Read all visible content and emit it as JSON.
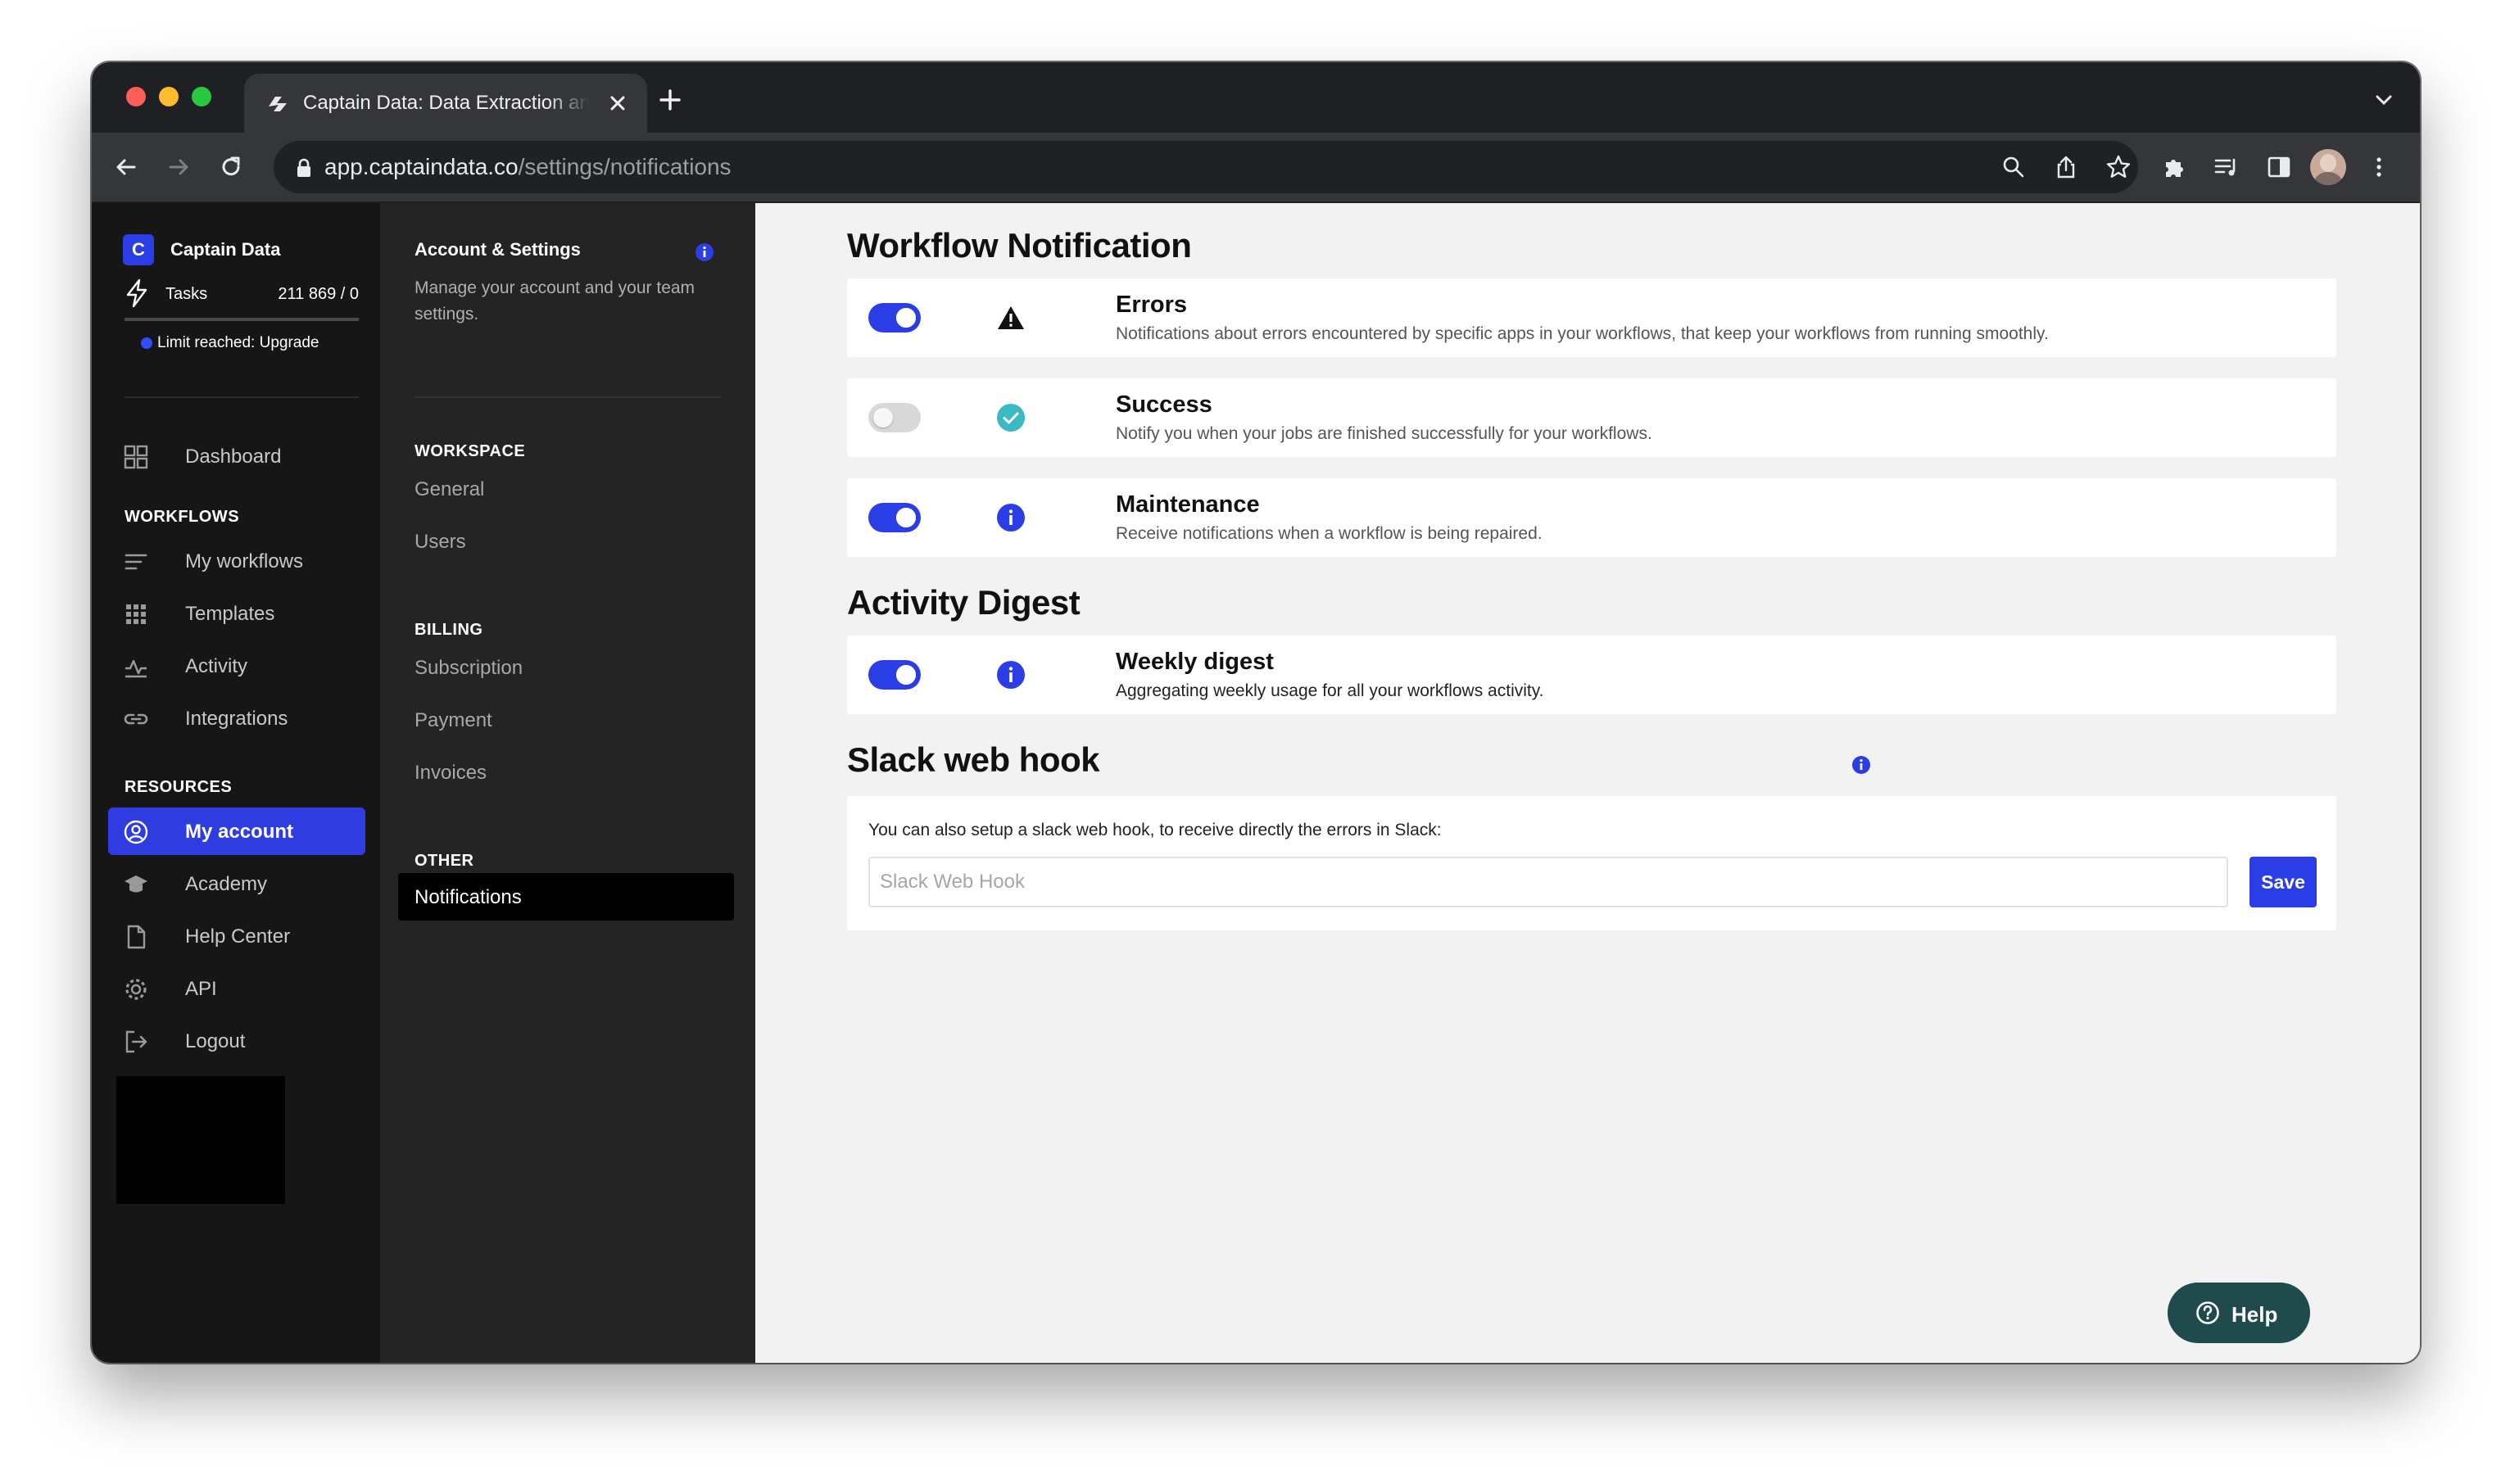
{
  "browser": {
    "tab_title": "Captain Data: Data Extraction and Automation",
    "url_domain": "app.captaindata.co",
    "url_path": "/settings/notifications"
  },
  "sidebar": {
    "brand_initial": "C",
    "brand_name": "Captain Data",
    "tasks_label": "Tasks",
    "tasks_count": "211 869 / 0",
    "tasks_progress": 1.0,
    "limit_text": "Limit reached: Upgrade",
    "dashboard": "Dashboard",
    "workflows_section": "WORKFLOWS",
    "workflows_items": [
      {
        "label": "My workflows",
        "icon": "list-icon"
      },
      {
        "label": "Templates",
        "icon": "grid-icon"
      },
      {
        "label": "Activity",
        "icon": "activity-icon"
      },
      {
        "label": "Integrations",
        "icon": "link-icon"
      }
    ],
    "resources_section": "RESOURCES",
    "resources_items": [
      {
        "label": "My account",
        "icon": "user-circle-icon",
        "active": true
      },
      {
        "label": "Academy",
        "icon": "graduation-cap-icon"
      },
      {
        "label": "Help Center",
        "icon": "document-icon"
      },
      {
        "label": "API",
        "icon": "gear-icon"
      },
      {
        "label": "Logout",
        "icon": "logout-icon"
      }
    ]
  },
  "subnav": {
    "title": "Account & Settings",
    "description": "Manage your account and your team settings.",
    "workspace_section": "WORKSPACE",
    "workspace_items": [
      "General",
      "Users"
    ],
    "billing_section": "BILLING",
    "billing_items": [
      "Subscription",
      "Payment",
      "Invoices"
    ],
    "other_section": "OTHER",
    "other_items": [
      "Notifications"
    ]
  },
  "main": {
    "workflow_heading": "Workflow Notification",
    "notifications": [
      {
        "title": "Errors",
        "description": "Notifications about errors encountered by specific apps in your workflows, that keep your workflows from running smoothly.",
        "enabled": true,
        "icon": "warning-icon"
      },
      {
        "title": "Success",
        "description": "Notify you when your jobs are finished successfully for your workflows.",
        "enabled": false,
        "icon": "check-circle-icon"
      },
      {
        "title": "Maintenance",
        "description": "Receive notifications when a workflow is being repaired.",
        "enabled": true,
        "icon": "info-icon"
      }
    ],
    "digest_heading": "Activity Digest",
    "digest": {
      "title": "Weekly digest",
      "description": "Aggregating weekly usage for all your workflows activity.",
      "enabled": true,
      "icon": "info-icon"
    },
    "slack_heading": "Slack web hook",
    "slack_text": "You can also setup a slack web hook, to receive directly the errors in Slack:",
    "slack_placeholder": "Slack Web Hook",
    "slack_value": "",
    "save_label": "Save",
    "help_label": "Help"
  },
  "colors": {
    "accent": "#2b3ee6",
    "sidebar_bg": "#161616",
    "subnav_bg": "#242424",
    "main_bg": "#f2f2f2",
    "success": "#3bb9c4",
    "help_bg": "#1f4b4d"
  }
}
